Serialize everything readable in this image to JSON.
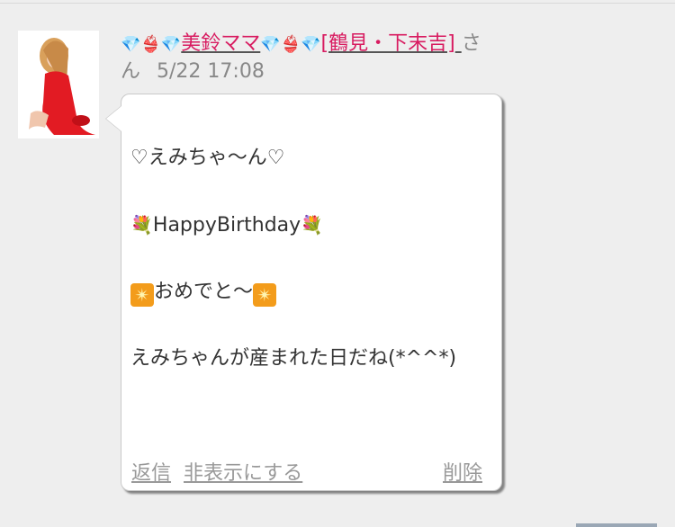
{
  "post": {
    "author_name": "美鈴ママ",
    "author_area": "[鶴見・下末吉]",
    "honorific": "さん",
    "timestamp": "5/22 17:08",
    "message_lines": [
      "♡えみちゃ〜ん♡",
      "HappyBirthday",
      "おめでと〜",
      "えみちゃんが産まれた日だね(*^^*)"
    ],
    "emoji": {
      "diamond": "💎",
      "bikini": "👙",
      "bouquet": "💐",
      "sparkle": "✴"
    },
    "actions": {
      "reply": "返信",
      "hide": "非表示にする",
      "delete": "削除"
    }
  },
  "colors": {
    "background": "#eeeeee",
    "author_link": "#d81b60",
    "muted_text": "#888888",
    "action_text": "#999999"
  }
}
